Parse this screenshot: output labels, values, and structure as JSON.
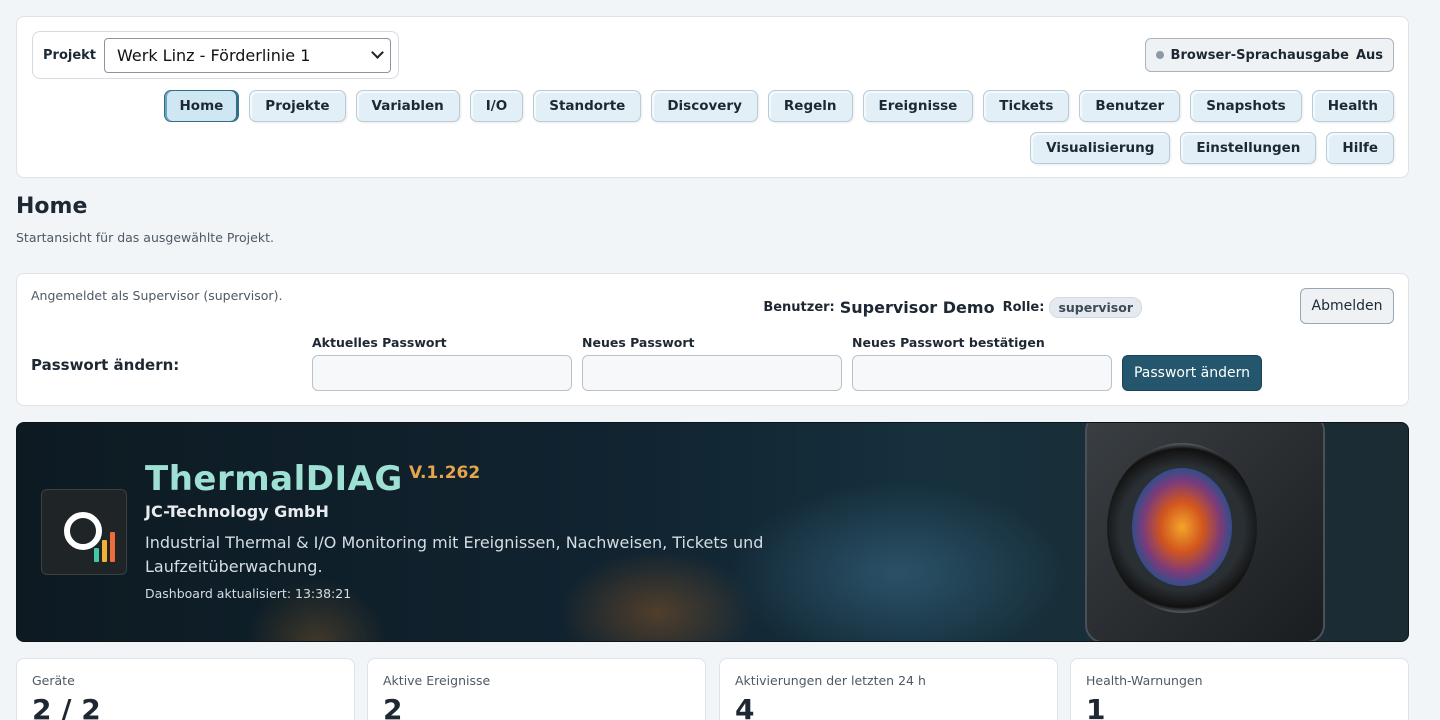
{
  "project": {
    "label": "Projekt",
    "selected": "Werk Linz - Förderlinie 1"
  },
  "speech": {
    "label": "Browser-Sprachausgabe",
    "state": "Aus"
  },
  "nav": {
    "items": [
      {
        "label": "Home",
        "active": true
      },
      {
        "label": "Projekte"
      },
      {
        "label": "Variablen"
      },
      {
        "label": "I/O"
      },
      {
        "label": "Standorte"
      },
      {
        "label": "Discovery"
      },
      {
        "label": "Regeln"
      },
      {
        "label": "Ereignisse"
      },
      {
        "label": "Tickets"
      },
      {
        "label": "Benutzer"
      },
      {
        "label": "Snapshots"
      },
      {
        "label": "Health"
      },
      {
        "label": "Visualisierung"
      },
      {
        "label": "Einstellungen"
      },
      {
        "label": "Hilfe"
      }
    ]
  },
  "page": {
    "title": "Home",
    "subtitle": "Startansicht für das ausgewählte Projekt."
  },
  "account": {
    "logged_in_text": "Angemeldet als Supervisor (supervisor).",
    "user_label": "Benutzer:",
    "user_name": "Supervisor Demo",
    "role_label": "Rolle:",
    "role": "supervisor",
    "logout_label": "Abmelden",
    "pw_section_label": "Passwort ändern:",
    "current_pw_label": "Aktuelles Passwort",
    "new_pw_label": "Neues Passwort",
    "confirm_pw_label": "Neues Passwort bestätigen",
    "submit_label": "Passwort ändern"
  },
  "hero": {
    "title": "ThermalDIAG",
    "version": "V.1.262",
    "company": "JC-Technology GmbH",
    "description": "Industrial Thermal & I/O Monitoring mit Ereignissen, Nachweisen, Tickets und Laufzeitüberwachung.",
    "updated": "Dashboard aktualisiert: 13:38:21"
  },
  "stats": [
    {
      "label": "Geräte",
      "value": "2 / 2"
    },
    {
      "label": "Aktive Ereignisse",
      "value": "2"
    },
    {
      "label": "Aktivierungen der letzten 24 h",
      "value": "4"
    },
    {
      "label": "Health-Warnungen",
      "value": "1"
    }
  ],
  "colors": {
    "accent": "#24576e",
    "hero_title": "#9fe0d4",
    "hero_version": "#e5a54a"
  }
}
